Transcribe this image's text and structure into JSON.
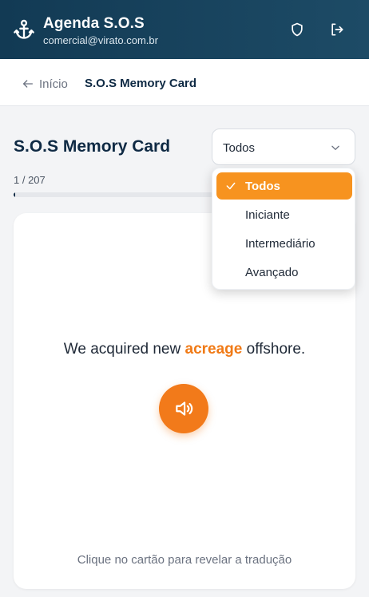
{
  "header": {
    "title": "Agenda S.O.S",
    "email": "comercial@virato.com.br"
  },
  "breadcrumb": {
    "back_label": "Início",
    "current": "S.O.S Memory Card"
  },
  "main": {
    "title": "S.O.S Memory Card",
    "filter_value": "Todos",
    "counter": "1 / 207",
    "progress_fraction": 0.005
  },
  "dropdown": {
    "options": [
      "Todos",
      "Iniciante",
      "Intermediário",
      "Avançado"
    ],
    "selected_index": 0
  },
  "card": {
    "sentence_before": "We acquired new ",
    "sentence_highlight": "acreage",
    "sentence_after": " offshore.",
    "hint": "Clique no cartão para revelar a tradução"
  },
  "colors": {
    "header_bg": "#123a54",
    "accent": "#f7931f",
    "audio_button": "#f27a1a"
  },
  "icons": [
    "anchor-icon",
    "shield-icon",
    "logout-icon",
    "arrow-left-icon",
    "chevron-down-icon",
    "check-icon",
    "speaker-icon"
  ]
}
